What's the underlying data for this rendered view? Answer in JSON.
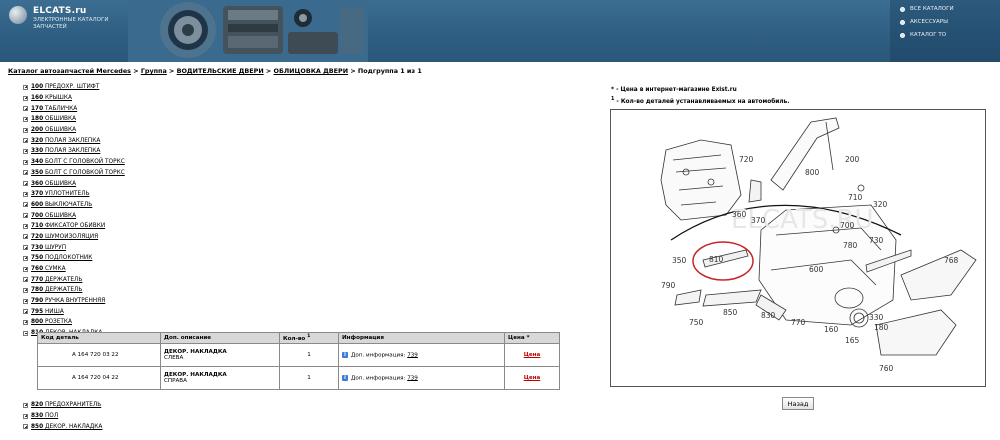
{
  "header": {
    "logo_title": "ELCATS.ru",
    "logo_subtitle": "ЭЛЕКТРОННЫЕ КАТАЛОГИ ЗАПЧАСТЕЙ",
    "nav": [
      "ВСЕ КАТАЛОГИ",
      "АКСЕССУАРЫ",
      "КАТАЛОГ ТО"
    ]
  },
  "breadcrumb": {
    "items": [
      "Каталог автозапчастей Mercedes",
      "Группа",
      "ВОДИТЕЛЬСКИЕ ДВЕРИ",
      "ОБЛИЦОВКА ДВЕРИ"
    ],
    "separator": ">",
    "current": "Подгруппа 1 из 1"
  },
  "tree": [
    {
      "num": "100",
      "label": " ПРЕДОХР. ШТИФТ"
    },
    {
      "num": "160",
      "label": " КРЫШКА"
    },
    {
      "num": "170",
      "label": " ТАБЛИЧКА"
    },
    {
      "num": "180",
      "label": " ОБШИВКА"
    },
    {
      "num": "200",
      "label": " ОБШИВКА"
    },
    {
      "num": "320",
      "label": " ПОЛАЯ ЗАКЛЕПКА"
    },
    {
      "num": "330",
      "label": " ПОЛАЯ ЗАКЛЕПКА"
    },
    {
      "num": "340",
      "label": " БОЛТ С ГОЛОВКОЙ ТОРКС"
    },
    {
      "num": "350",
      "label": " БОЛТ С ГОЛОВКОЙ ТОРКС"
    },
    {
      "num": "360",
      "label": " ОБШИВКА"
    },
    {
      "num": "370",
      "label": " УПЛОТНИТЕЛЬ"
    },
    {
      "num": "600",
      "label": " ВЫКЛЮЧАТЕЛЬ"
    },
    {
      "num": "700",
      "label": " ОБШИВКА"
    },
    {
      "num": "710",
      "label": " ФИКСАТОР ОБИВКИ"
    },
    {
      "num": "720",
      "label": " ШУМОИЗОЛЯЦИЯ"
    },
    {
      "num": "730",
      "label": " ШУРУП"
    },
    {
      "num": "750",
      "label": " ПОДЛОКОТНИК"
    },
    {
      "num": "760",
      "label": " СУМКА"
    },
    {
      "num": "770",
      "label": " ДЕРЖАТЕЛЬ"
    },
    {
      "num": "780",
      "label": " ДЕРЖАТЕЛЬ"
    },
    {
      "num": "790",
      "label": " РУЧКА ВНУТРЕННЯЯ"
    },
    {
      "num": "795",
      "label": " НИША"
    },
    {
      "num": "800",
      "label": " РОЗЕТКА"
    },
    {
      "num": "810",
      "label": " ДЕКОР. НАКЛАДКА"
    }
  ],
  "table": {
    "headers": [
      "Код деталь",
      "Доп. описание",
      "Кол-во",
      "Информация",
      "Цена"
    ],
    "qty_sup": "1",
    "price_mark": "*",
    "rows": [
      {
        "code": "A  164 720 03 22",
        "desc1": "ДЕКОР. НАКЛАДКА",
        "desc2": "СЛЕВА",
        "qty": "1",
        "info_label": "Доп. информация:",
        "info_link": "739",
        "price": "Цена"
      },
      {
        "code": "A  164 720 04 22",
        "desc1": "ДЕКОР. НАКЛАДКА",
        "desc2": "СПРАВА",
        "qty": "1",
        "info_label": "Доп. информация:",
        "info_link": "739",
        "price": "Цена"
      }
    ]
  },
  "tree_after": [
    {
      "num": "820",
      "label": " ПРЕДОХРАНИТЕЛЬ"
    },
    {
      "num": "830",
      "label": " ПОЛ"
    },
    {
      "num": "850",
      "label": " ДЕКОР. НАКЛАДКА"
    }
  ],
  "notes": {
    "n1_mark": "*",
    "n1_text": " - Цена в интернет-магазине Exist.ru",
    "n2_mark": "1",
    "n2_text": " - Кол-во деталей устанавливаемых на автомобиль."
  },
  "diagram": {
    "labels": [
      "720",
      "200",
      "800",
      "360",
      "370",
      "710",
      "320",
      "700",
      "780",
      "730",
      "350",
      "810",
      "600",
      "768",
      "790",
      "750",
      "850",
      "830",
      "770",
      "160",
      "330",
      "180",
      "165",
      "760"
    ],
    "watermark": "ELCATS.RU"
  },
  "back_button": "Назад"
}
